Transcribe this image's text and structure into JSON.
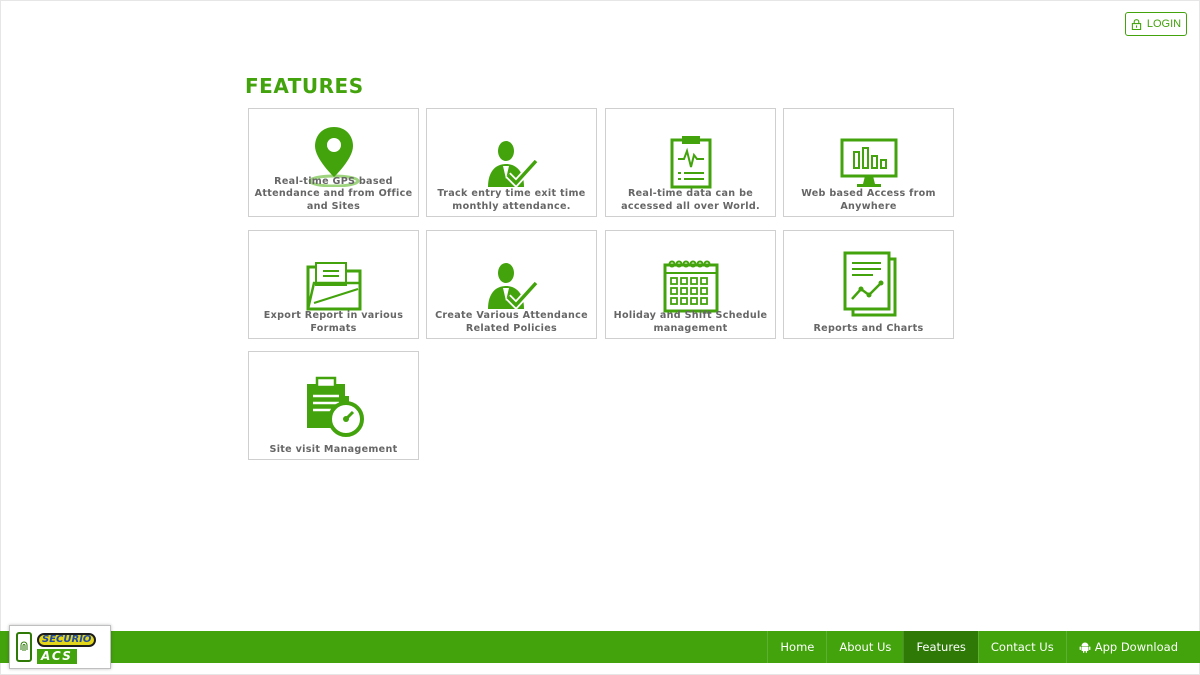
{
  "header": {
    "login_label": "LOGIN"
  },
  "main": {
    "title": "FEATURES",
    "cards": [
      {
        "label": "Real-time GPS based Attendance and from Office and Sites",
        "icon": "map-pin-icon"
      },
      {
        "label": "Track entry time exit time monthly attendance.",
        "icon": "user-check-icon"
      },
      {
        "label": "Real-time data can be accessed all over World.",
        "icon": "clipboard-pulse-icon"
      },
      {
        "label": "Web based Access from Anywhere",
        "icon": "monitor-chart-icon"
      },
      {
        "label": "Export Report in various Formats",
        "icon": "folder-icon"
      },
      {
        "label": "Create Various Attendance Related Policies",
        "icon": "user-check-icon"
      },
      {
        "label": "Holiday and Shift Schedule management",
        "icon": "calendar-icon"
      },
      {
        "label": "Reports and Charts",
        "icon": "report-chart-icon"
      },
      {
        "label": "Site visit Management",
        "icon": "clipboard-stopwatch-icon"
      }
    ]
  },
  "footer": {
    "nav": [
      {
        "label": "Home",
        "active": false
      },
      {
        "label": "About Us",
        "active": false
      },
      {
        "label": "Features",
        "active": true
      },
      {
        "label": "Contact Us",
        "active": false
      },
      {
        "label": "App Download",
        "active": false,
        "icon": "android-icon"
      }
    ],
    "logo": {
      "word1": "SECURIO",
      "word2": "ACS"
    }
  },
  "colors": {
    "accent": "#43a30c",
    "accent_dark": "#2f7a07"
  }
}
